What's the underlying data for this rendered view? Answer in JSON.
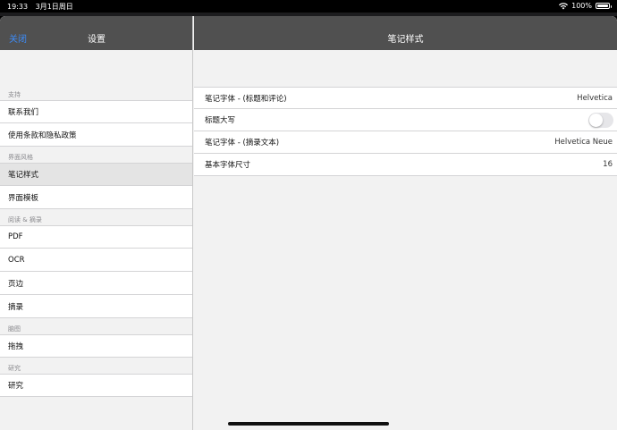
{
  "status_bar": {
    "time": "19:33",
    "date": "3月1日周日",
    "battery": "100%",
    "battery_level": 1.0
  },
  "left_nav": {
    "close_label": "关闭",
    "title": "设置"
  },
  "right_nav": {
    "title": "笔记样式"
  },
  "sidebar": {
    "sections": [
      {
        "header": "支持",
        "items": [
          "联系我们",
          "使用条款和隐私政策"
        ]
      },
      {
        "header": "界面风格",
        "items": [
          "笔记样式",
          "界面模板"
        ]
      },
      {
        "header": "阅读 & 摘录",
        "items": [
          "PDF",
          "OCR",
          "页边",
          "摘录"
        ]
      },
      {
        "header": "脑图",
        "items": [
          "拖拽"
        ]
      },
      {
        "header": "研究",
        "items": [
          "研究"
        ]
      }
    ],
    "selected": "笔记样式"
  },
  "settings": {
    "note_font_title": {
      "label": "笔记字体 - (标题和评论)",
      "value": "Helvetica"
    },
    "title_uppercase": {
      "label": "标题大写",
      "enabled": false
    },
    "note_font_excerpt": {
      "label": "笔记字体 - (摘录文本)",
      "value": "Helvetica Neue"
    },
    "base_font_size": {
      "label": "基本字体尺寸",
      "value": "16"
    }
  }
}
